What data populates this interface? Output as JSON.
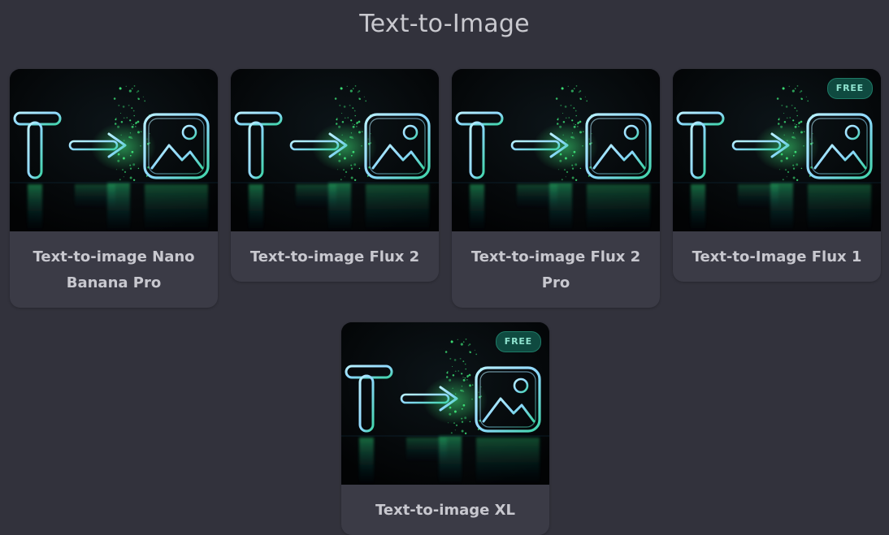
{
  "page": {
    "title": "Text-to-Image"
  },
  "cards": [
    {
      "label": "Text-to-image Nano Banana Pro",
      "badge": ""
    },
    {
      "label": "Text-to-image Flux 2",
      "badge": ""
    },
    {
      "label": "Text-to-image Flux 2 Pro",
      "badge": ""
    },
    {
      "label": "Text-to-Image Flux 1",
      "badge": "FREE"
    },
    {
      "label": "Text-to-image XL",
      "badge": "FREE"
    }
  ],
  "thumbnail": {
    "icon": "text-arrow-image-neon-icon",
    "accent": "#3ee87a",
    "glass": "#8fd8ff"
  }
}
